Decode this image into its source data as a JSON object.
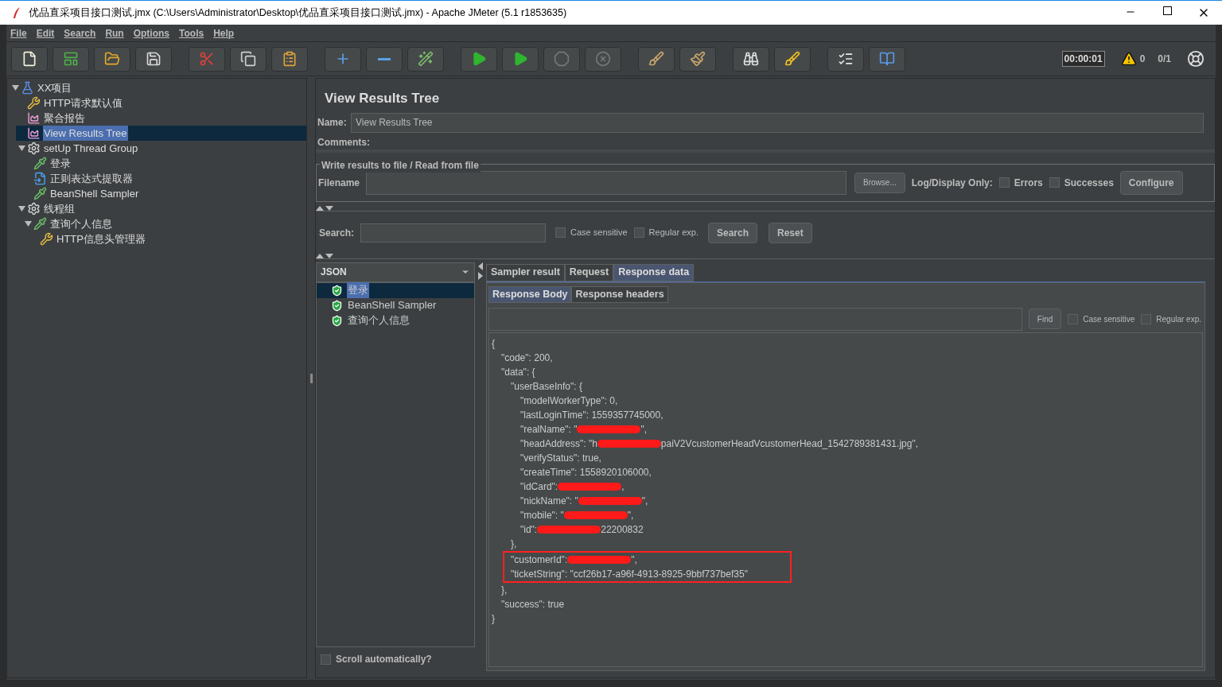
{
  "window": {
    "title": "优品直采项目接口测试.jmx (C:\\Users\\Administrator\\Desktop\\优品直采项目接口测试.jmx) - Apache JMeter (5.1 r1853635)"
  },
  "menu": [
    "File",
    "Edit",
    "Search",
    "Run",
    "Options",
    "Tools",
    "Help"
  ],
  "toolbar": [
    {
      "kind": "new",
      "disabled": false
    },
    {
      "kind": "templates",
      "disabled": false
    },
    {
      "kind": "open",
      "disabled": false
    },
    {
      "kind": "save",
      "disabled": false
    },
    {
      "kind": "gap"
    },
    {
      "kind": "cut",
      "disabled": false
    },
    {
      "kind": "copy",
      "disabled": false
    },
    {
      "kind": "paste",
      "disabled": false
    },
    {
      "kind": "gap"
    },
    {
      "kind": "expand",
      "disabled": false
    },
    {
      "kind": "collapse",
      "disabled": false
    },
    {
      "kind": "toggle",
      "disabled": false
    },
    {
      "kind": "gap"
    },
    {
      "kind": "start",
      "disabled": false
    },
    {
      "kind": "start-no-pause",
      "disabled": false
    },
    {
      "kind": "stop",
      "disabled": true
    },
    {
      "kind": "shutdown",
      "disabled": true
    },
    {
      "kind": "gap"
    },
    {
      "kind": "clear",
      "disabled": false
    },
    {
      "kind": "clear-all",
      "disabled": false
    },
    {
      "kind": "gap"
    },
    {
      "kind": "search",
      "disabled": false
    },
    {
      "kind": "reset-search",
      "disabled": false
    },
    {
      "kind": "gap"
    },
    {
      "kind": "functions",
      "disabled": false
    },
    {
      "kind": "help",
      "disabled": false
    }
  ],
  "status": {
    "timer": "00:00:01",
    "warnings": "0",
    "threads": "0/1"
  },
  "tree": [
    {
      "label": "XX项目",
      "kind": "testplan",
      "expanded": true,
      "selected": false,
      "children": [
        {
          "label": "HTTP请求默认值",
          "kind": "config",
          "selected": false
        },
        {
          "label": "聚合报告",
          "kind": "listener",
          "selected": false
        },
        {
          "label": "View Results Tree",
          "kind": "listener",
          "selected": true
        },
        {
          "label": "setUp Thread Group",
          "kind": "threadgroup",
          "expanded": true,
          "selected": false,
          "children": [
            {
              "label": "登录",
              "kind": "sampler",
              "selected": false
            },
            {
              "label": "正则表达式提取器",
              "kind": "extractor",
              "selected": false
            },
            {
              "label": "BeanShell Sampler",
              "kind": "sampler",
              "selected": false
            }
          ]
        },
        {
          "label": "线程组",
          "kind": "threadgroup",
          "expanded": true,
          "selected": false,
          "children": [
            {
              "label": "查询个人信息",
              "kind": "sampler",
              "expanded": true,
              "selected": false,
              "children": [
                {
                  "label": "HTTP信息头管理器",
                  "kind": "config",
                  "selected": false
                }
              ]
            }
          ]
        }
      ]
    }
  ],
  "panel": {
    "title": "View Results Tree",
    "name_label": "Name:",
    "name_value": "View Results Tree",
    "comments_label": "Comments:",
    "file_group": {
      "legend": "Write results to file / Read from file",
      "filename_label": "Filename",
      "browse": "Browse...",
      "log_label": "Log/Display Only:",
      "errors": {
        "label": "Errors",
        "checked": false
      },
      "successes": {
        "label": "Successes",
        "checked": false
      },
      "configure": "Configure"
    },
    "search": {
      "label": "Search:",
      "case_sensitive": {
        "label": "Case sensitive",
        "checked": false
      },
      "regex": {
        "label": "Regular exp.",
        "checked": false
      },
      "search_button": "Search",
      "reset_button": "Reset"
    },
    "renderer": "JSON",
    "results": [
      {
        "label": "登录",
        "selected": true
      },
      {
        "label": "BeanShell Sampler",
        "selected": false
      },
      {
        "label": "查询个人信息",
        "selected": false
      }
    ],
    "scroll_auto": {
      "label": "Scroll automatically?",
      "checked": false
    },
    "tabs": [
      {
        "label": "Sampler result",
        "selected": false
      },
      {
        "label": "Request",
        "selected": false
      },
      {
        "label": "Response data",
        "selected": true
      }
    ],
    "subtabs": [
      {
        "label": "Response Body",
        "selected": true
      },
      {
        "label": "Response headers",
        "selected": false
      }
    ],
    "find": {
      "button": "Find",
      "case_sensitive": {
        "label": "Case sensitive",
        "checked": false
      },
      "regex": {
        "label": "Regular exp.",
        "checked": false
      }
    },
    "body": [
      {
        "text": "{",
        "children": [
          {
            "text": "\"code\": 200,"
          },
          {
            "text": "\"data\": {",
            "children": [
              {
                "text": "\"userBaseInfo\": {",
                "children": [
                  {
                    "text": "\"modelWorkerType\": 0,"
                  },
                  {
                    "text": "\"lastLoginTime\": 1559357745000,"
                  },
                  {
                    "text": "\"realName\": \"",
                    "redacted": true,
                    "after": "\","
                  },
                  {
                    "text": "\"headAddress\": \"h",
                    "redacted": true,
                    "after": "paiV2VcustomerHeadVcustomerHead_1542789381431.jpg\","
                  },
                  {
                    "text": "\"verifyStatus\": true,"
                  },
                  {
                    "text": "\"createTime\": 1558920106000,"
                  },
                  {
                    "text": "\"idCard\": ",
                    "redacted": true,
                    "after": ","
                  },
                  {
                    "text": "\"nickName\": \"",
                    "redacted": true,
                    "after": "\","
                  },
                  {
                    "text": "\"mobile\": \"",
                    "redacted": true,
                    "after": "\","
                  },
                  {
                    "text": "\"id\": ",
                    "redacted": true,
                    "after": "22200832"
                  }
                ]
              },
              {
                "text": "},"
              },
              {
                "text": "\"customerId\": ",
                "redacted": true,
                "after": "\",",
                "boxed": true
              },
              {
                "text": "\"ticketString\": \"ccf26b17-a96f-4913-8925-9bbf737bef35\"",
                "boxed": true
              }
            ]
          },
          {
            "text": "},"
          },
          {
            "text": "\"success\": true"
          }
        ]
      },
      {
        "text": "}"
      }
    ]
  }
}
